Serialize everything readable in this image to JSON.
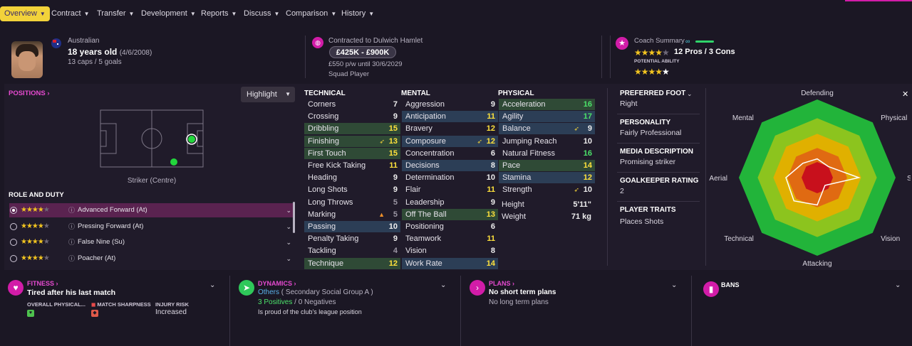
{
  "nav": {
    "items": [
      "Overview",
      "Contract",
      "Transfer",
      "Development",
      "Reports",
      "Discuss",
      "Comparison",
      "History"
    ]
  },
  "player": {
    "nationality": "Australian",
    "age": "18 years old",
    "dob": "(4/6/2008)",
    "caps": "13 caps / 5 goals"
  },
  "contract": {
    "title": "Contracted to Dulwich Hamlet",
    "value": "£425K - £900K",
    "wage": "£550 p/w until 30/6/2029",
    "status": "Squad Player"
  },
  "coach": {
    "title": "Coach Summary",
    "current_stars": 4,
    "pros_cons": "12 Pros / 3 Cons",
    "potential_label": "POTENTIAL ABILITY",
    "potential_stars": 4.5
  },
  "positions": {
    "title": "POSITIONS",
    "highlight_label": "Highlight",
    "position_name": "Striker (Centre)",
    "role_title": "ROLE AND DUTY",
    "roles": [
      {
        "name": "Advanced Forward (At)",
        "stars": 4,
        "selected": true
      },
      {
        "name": "Pressing Forward (At)",
        "stars": 4,
        "selected": false
      },
      {
        "name": "False Nine (Su)",
        "stars": 4,
        "selected": false
      },
      {
        "name": "Poacher (At)",
        "stars": 4,
        "selected": false
      }
    ]
  },
  "technical": {
    "title": "TECHNICAL",
    "rows": [
      {
        "name": "Corners",
        "value": "7",
        "bg": "dark",
        "color": "white"
      },
      {
        "name": "Crossing",
        "value": "9",
        "bg": "dark",
        "color": "white"
      },
      {
        "name": "Dribbling",
        "value": "15",
        "bg": "green",
        "color": "yellow"
      },
      {
        "name": "Finishing",
        "value": "13",
        "bg": "green",
        "color": "yellow",
        "flag": "up"
      },
      {
        "name": "First Touch",
        "value": "15",
        "bg": "green",
        "color": "yellow"
      },
      {
        "name": "Free Kick Taking",
        "value": "11",
        "bg": "dark",
        "color": "yellow"
      },
      {
        "name": "Heading",
        "value": "9",
        "bg": "dark",
        "color": "white"
      },
      {
        "name": "Long Shots",
        "value": "9",
        "bg": "dark",
        "color": "white"
      },
      {
        "name": "Long Throws",
        "value": "5",
        "bg": "dark",
        "color": "gray"
      },
      {
        "name": "Marking",
        "value": "5",
        "bg": "dark",
        "color": "gray",
        "flag": "tri"
      },
      {
        "name": "Passing",
        "value": "10",
        "bg": "blue",
        "color": "white"
      },
      {
        "name": "Penalty Taking",
        "value": "9",
        "bg": "dark",
        "color": "white"
      },
      {
        "name": "Tackling",
        "value": "4",
        "bg": "dark",
        "color": "gray"
      },
      {
        "name": "Technique",
        "value": "12",
        "bg": "green",
        "color": "yellow"
      }
    ]
  },
  "mental": {
    "title": "MENTAL",
    "rows": [
      {
        "name": "Aggression",
        "value": "9",
        "bg": "dark",
        "color": "white"
      },
      {
        "name": "Anticipation",
        "value": "11",
        "bg": "blue",
        "color": "yellow"
      },
      {
        "name": "Bravery",
        "value": "12",
        "bg": "dark",
        "color": "yellow"
      },
      {
        "name": "Composure",
        "value": "12",
        "bg": "blue",
        "color": "yellow",
        "flag": "up"
      },
      {
        "name": "Concentration",
        "value": "6",
        "bg": "dark",
        "color": "white"
      },
      {
        "name": "Decisions",
        "value": "8",
        "bg": "blue",
        "color": "white"
      },
      {
        "name": "Determination",
        "value": "10",
        "bg": "dark",
        "color": "white"
      },
      {
        "name": "Flair",
        "value": "11",
        "bg": "dark",
        "color": "yellow"
      },
      {
        "name": "Leadership",
        "value": "9",
        "bg": "dark",
        "color": "white"
      },
      {
        "name": "Off The Ball",
        "value": "13",
        "bg": "green",
        "color": "yellow"
      },
      {
        "name": "Positioning",
        "value": "6",
        "bg": "dark",
        "color": "white"
      },
      {
        "name": "Teamwork",
        "value": "11",
        "bg": "dark",
        "color": "yellow"
      },
      {
        "name": "Vision",
        "value": "8",
        "bg": "dark",
        "color": "white"
      },
      {
        "name": "Work Rate",
        "value": "14",
        "bg": "blue",
        "color": "yellow"
      }
    ]
  },
  "physical": {
    "title": "PHYSICAL",
    "rows": [
      {
        "name": "Acceleration",
        "value": "16",
        "bg": "green",
        "color": "green"
      },
      {
        "name": "Agility",
        "value": "17",
        "bg": "blue",
        "color": "green"
      },
      {
        "name": "Balance",
        "value": "9",
        "bg": "blue",
        "color": "white",
        "flag": "up"
      },
      {
        "name": "Jumping Reach",
        "value": "10",
        "bg": "dark",
        "color": "white"
      },
      {
        "name": "Natural Fitness",
        "value": "16",
        "bg": "dark",
        "color": "green"
      },
      {
        "name": "Pace",
        "value": "14",
        "bg": "green",
        "color": "yellow"
      },
      {
        "name": "Stamina",
        "value": "12",
        "bg": "blue",
        "color": "yellow"
      },
      {
        "name": "Strength",
        "value": "10",
        "bg": "dark",
        "color": "white",
        "flag": "up"
      }
    ],
    "height_label": "Height",
    "height_value": "5'11\"",
    "weight_label": "Weight",
    "weight_value": "71 kg"
  },
  "info": {
    "foot_label": "PREFERRED FOOT",
    "foot_value": "Right",
    "personality_label": "PERSONALITY",
    "personality_value": "Fairly Professional",
    "media_label": "MEDIA DESCRIPTION",
    "media_value": "Promising striker",
    "gk_label": "GOALKEEPER RATING",
    "gk_value": "2",
    "traits_label": "PLAYER TRAITS",
    "traits_value": "Places Shots"
  },
  "radar": {
    "labels": [
      "Defending",
      "Physical",
      "Speed",
      "Vision",
      "Attacking",
      "Technical",
      "Aerial",
      "Mental"
    ],
    "levels": [
      0.24,
      0.2,
      0.53,
      0.14,
      0.35,
      0.42,
      0.4,
      0.26
    ]
  },
  "bottom": {
    "fitness_title": "FITNESS",
    "fitness_status": "Tired after his last match",
    "overall_label": "OVERALL PHYSICAL...",
    "sharpness_label": "MATCH SHARPNESS",
    "injury_label": "INJURY RISK",
    "injury_value": "Increased",
    "dynamics_title": "DYNAMICS",
    "social_group": "Others",
    "social_sub": "( Secondary Social Group A )",
    "positives": "3 Positives",
    "sep": "/",
    "negatives": "0 Negatives",
    "dyn_note": "Is proud of the club's league position",
    "plans_title": "PLANS",
    "plans_status": "No short term plans",
    "plans_long": "No long term plans",
    "bans_title": "BANS"
  },
  "colors": {
    "accent": "#d21ca8",
    "nav_active": "#f2d23a",
    "green_value": "#4ce36a",
    "yellow_value": "#ffe23c"
  }
}
